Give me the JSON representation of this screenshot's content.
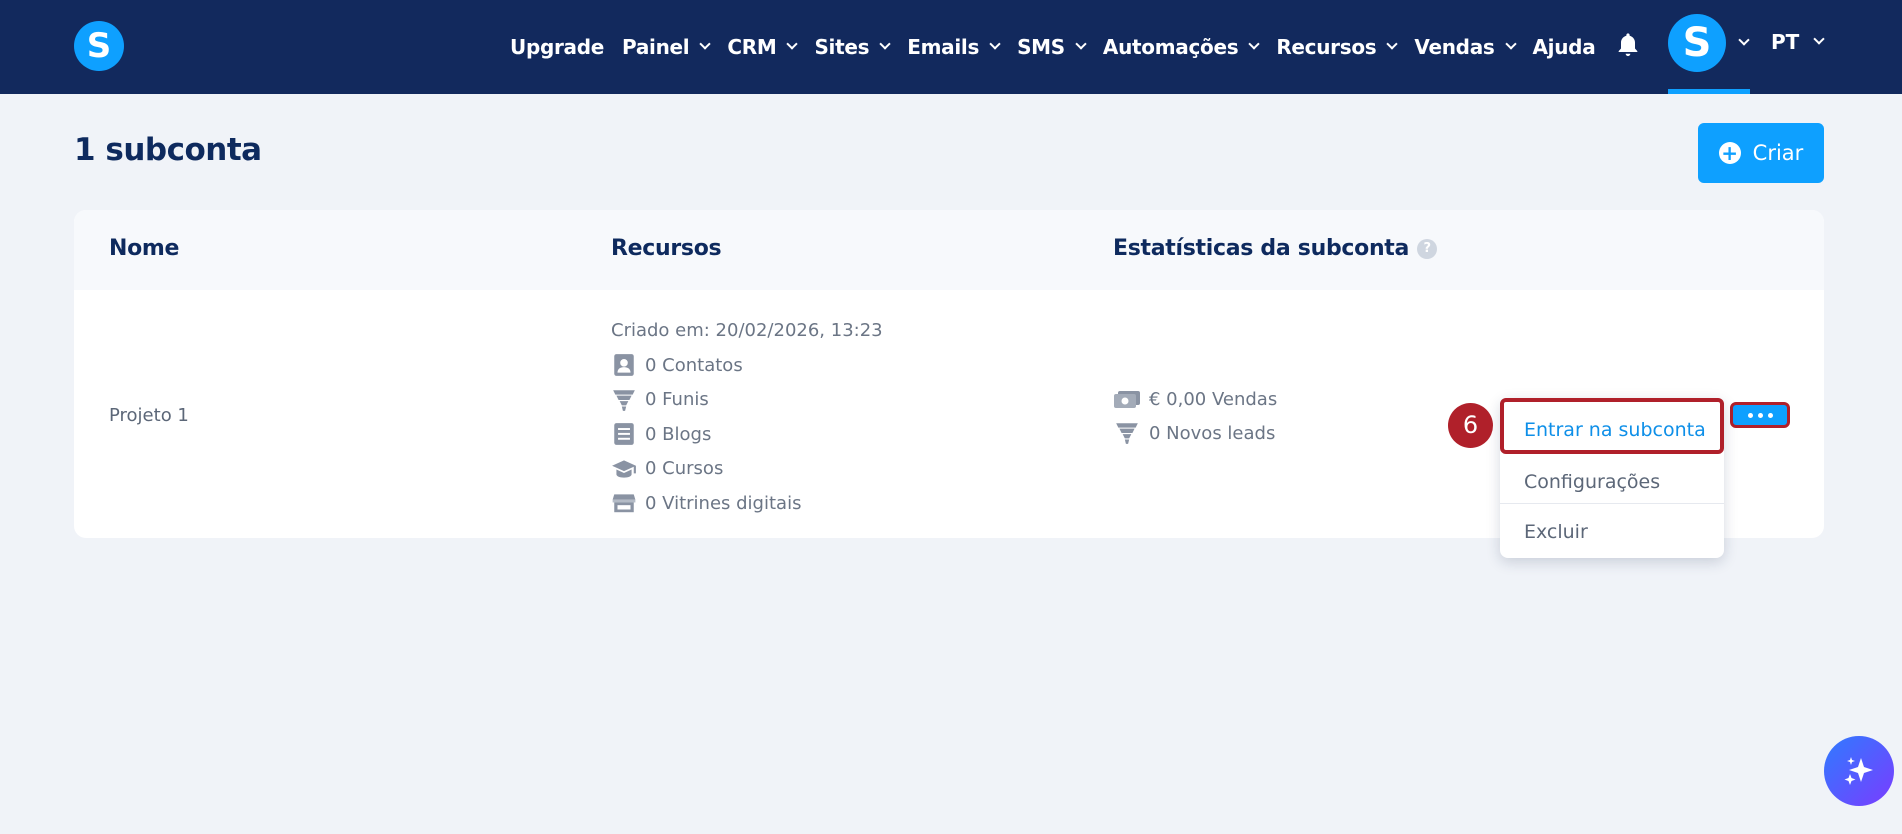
{
  "nav": {
    "logo_letter": "S",
    "items": [
      {
        "label": "Upgrade",
        "dropdown": false
      },
      {
        "label": "Painel",
        "dropdown": true
      },
      {
        "label": "CRM",
        "dropdown": true
      },
      {
        "label": "Sites",
        "dropdown": true
      },
      {
        "label": "Emails",
        "dropdown": true
      },
      {
        "label": "SMS",
        "dropdown": true
      },
      {
        "label": "Automações",
        "dropdown": true
      },
      {
        "label": "Recursos",
        "dropdown": true
      },
      {
        "label": "Vendas",
        "dropdown": true
      },
      {
        "label": "Ajuda",
        "dropdown": false
      }
    ],
    "avatar_letter": "S",
    "language": "PT"
  },
  "page": {
    "title": "1 subconta",
    "create_label": "Criar"
  },
  "table": {
    "headers": {
      "name": "Nome",
      "resources": "Recursos",
      "stats": "Estatísticas da subconta"
    },
    "help_glyph": "?",
    "row": {
      "name": "Projeto 1",
      "created": "Criado em: 20/02/2026, 13:23",
      "resources": [
        {
          "icon": "contacts-icon",
          "label": "0 Contatos"
        },
        {
          "icon": "funnel-icon",
          "label": "0 Funis"
        },
        {
          "icon": "blog-icon",
          "label": "0 Blogs"
        },
        {
          "icon": "graduation-cap-icon",
          "label": "0 Cursos"
        },
        {
          "icon": "storefront-icon",
          "label": "0 Vitrines digitais"
        }
      ],
      "stats": [
        {
          "icon": "money-icon",
          "label": "€ 0,00 Vendas"
        },
        {
          "icon": "funnel-icon",
          "label": "0 Novos leads"
        }
      ]
    }
  },
  "menu": {
    "items": [
      "Entrar na subconta",
      "Configurações",
      "Excluir"
    ]
  },
  "annotation": {
    "step": "6"
  },
  "colors": {
    "navbar": "#12295d",
    "accent": "#0ea0ff",
    "highlight": "#b0202a",
    "background": "#f0f3f8"
  }
}
